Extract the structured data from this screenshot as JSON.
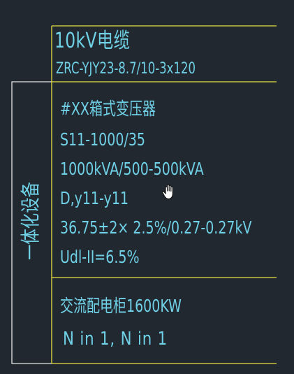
{
  "colors": {
    "background": "#212830",
    "frame_yellow": "#e8e040",
    "frame_white": "#e6e6e6",
    "text_cyan": "#6fd0e6"
  },
  "cable": {
    "title": "10kV电缆",
    "spec": "ZRC-YJY23-8.7/10-3x120"
  },
  "integrated_group": {
    "label": "一体化设备"
  },
  "transformer": {
    "name": "#XX箱式变压器",
    "model": "S11-1000/35",
    "capacity": "1000kVA/500-500kVA",
    "vector_group": "D,y11-y11",
    "voltage_ratio": "36.75±2× 2.5%/0.27-0.27kV",
    "impedance": "Udl-II=6.5%"
  },
  "ac_cabinet": {
    "title": "交流配电柜1600KW",
    "spec": "N in 1, N in 1"
  },
  "cursor": {
    "icon": "hand-pointer-icon"
  }
}
